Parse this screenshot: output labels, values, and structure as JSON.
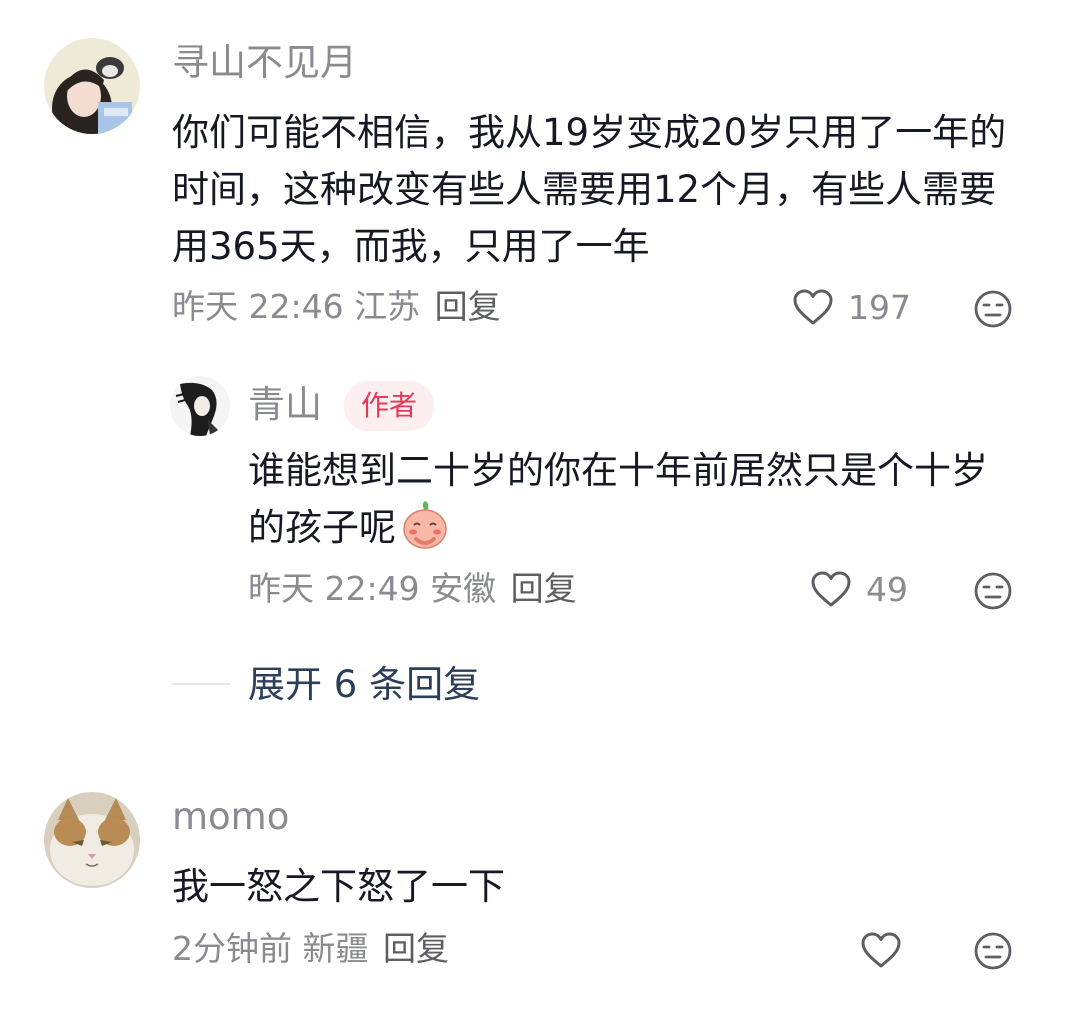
{
  "comments": [
    {
      "username": "寻山不见月",
      "content": "你们可能不相信，我从19岁变成20岁只用了一年的时间，这种改变有些人需要用12个月，有些人需要用365天，而我，只用了一年",
      "time": "昨天 22:46",
      "location": "江苏",
      "reply_label": "回复",
      "likes": "197",
      "avatar_icon": "girl-with-cat-avatar",
      "reply": {
        "username": "青山",
        "badge": "作者",
        "content": "谁能想到二十岁的你在十年前居然只是个十岁的孩子呢",
        "sticker_icon": "blushing-peach-emoji",
        "time": "昨天 22:49",
        "location": "安徽",
        "reply_label": "回复",
        "likes": "49",
        "avatar_icon": "ink-drawn-swordsman-avatar"
      },
      "expand_label": "展开 6 条回复"
    },
    {
      "username": "momo",
      "content": "我一怒之下怒了一下",
      "time": "2分钟前",
      "location": "新疆",
      "reply_label": "回复",
      "likes": "",
      "avatar_icon": "fluffy-cat-avatar"
    }
  ],
  "colors": {
    "text_primary": "#161823",
    "text_secondary": "#8a8b91",
    "author_badge_bg": "#fdeef0",
    "author_badge_text": "#e8375a",
    "expand_link": "#2c3e58"
  }
}
